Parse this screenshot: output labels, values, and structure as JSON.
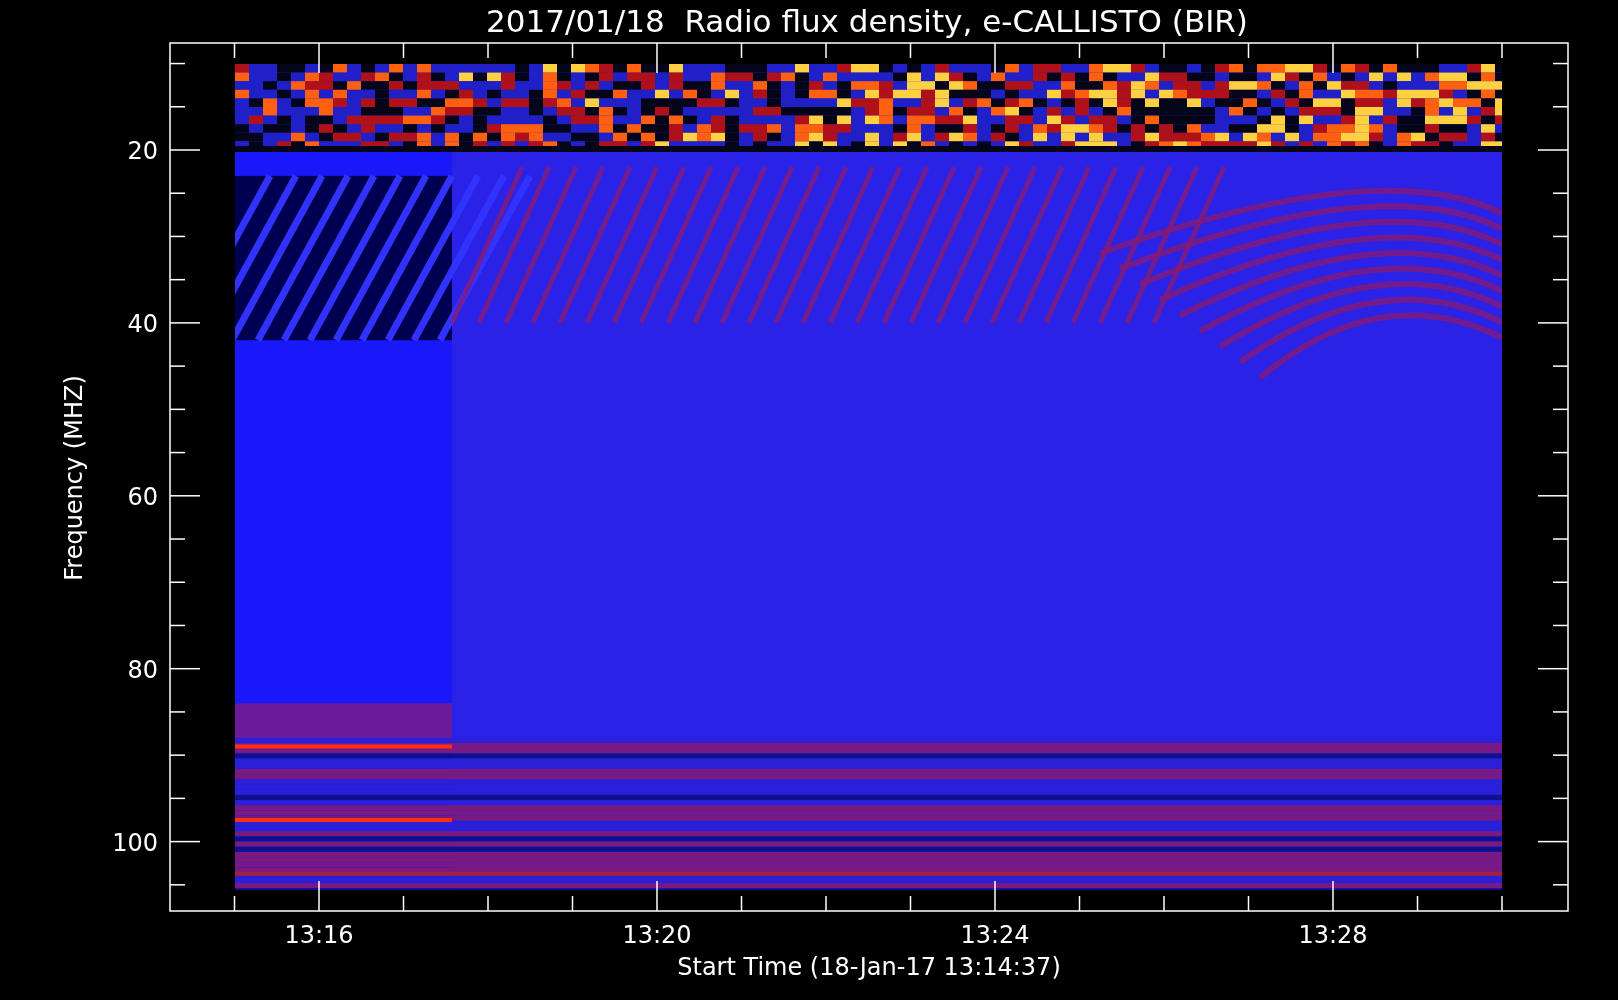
{
  "title": "2017/01/18  Radio flux density, e-CALLISTO (BIR)",
  "y_axis": {
    "label": "Frequency (MHZ)",
    "tick_labels": [
      "20",
      "40",
      "60",
      "80",
      "100"
    ]
  },
  "x_axis": {
    "label": "Start Time (18-Jan-17 13:14:37)",
    "tick_labels": [
      "13:16",
      "13:20",
      "13:24",
      "13:28"
    ]
  }
}
